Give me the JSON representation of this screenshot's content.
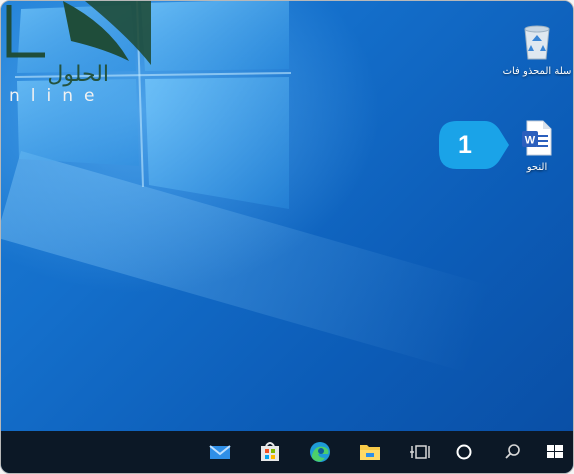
{
  "watermark": {
    "arabic_text": "الحلول",
    "latin_text": "nline"
  },
  "desktop": {
    "icons": [
      {
        "label": "سلة المحذو فات",
        "icon": "recycle-bin-icon"
      },
      {
        "label": "النحو",
        "icon": "word-document-icon",
        "badge": "W"
      }
    ],
    "callout": {
      "number": "1"
    }
  },
  "taskbar": {
    "items": [
      {
        "icon": "mail-icon"
      },
      {
        "icon": "store-icon"
      },
      {
        "icon": "edge-icon"
      },
      {
        "icon": "file-explorer-icon"
      },
      {
        "icon": "task-view-icon"
      },
      {
        "icon": "cortana-icon"
      },
      {
        "icon": "search-icon"
      },
      {
        "icon": "start-icon"
      }
    ]
  },
  "colors": {
    "desktop_blue": "#0c5cb7",
    "taskbar": "#0c1826",
    "callout_blue": "#1aa3e8",
    "word_blue": "#2b5fbd"
  }
}
